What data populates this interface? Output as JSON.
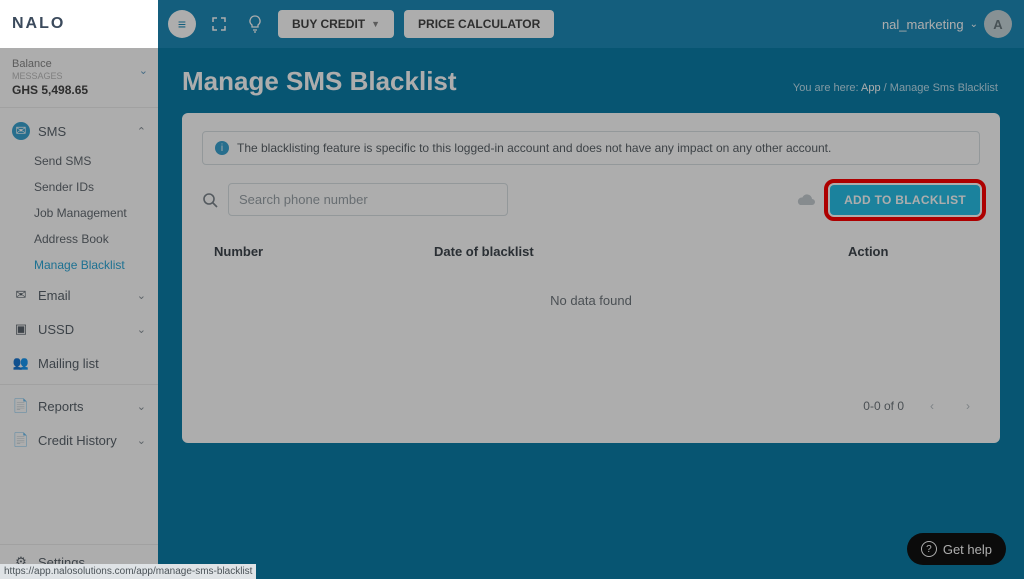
{
  "brand": "NALO",
  "topbar": {
    "buy_credit": "BUY CREDIT",
    "price_calc": "PRICE CALCULATOR",
    "username": "nal_marketing",
    "avatar_initial": "A"
  },
  "balance": {
    "label": "Balance",
    "sublabel": "MESSAGES",
    "value": "GHS 5,498.65"
  },
  "nav": {
    "sms": {
      "label": "SMS"
    },
    "sms_items": [
      "Send SMS",
      "Sender IDs",
      "Job Management",
      "Address Book",
      "Manage Blacklist"
    ],
    "email": "Email",
    "ussd": "USSD",
    "mailing": "Mailing list",
    "reports": "Reports",
    "credit_history": "Credit History",
    "settings": "Settings"
  },
  "page": {
    "title": "Manage SMS Blacklist",
    "crumb_prefix": "You are here:",
    "crumb_app": "App",
    "crumb_current": "Manage Sms Blacklist",
    "alert": "The blacklisting feature is specific to this logged-in account and does not have any impact on any other account.",
    "search_placeholder": "Search phone number",
    "add_btn": "ADD TO BLACKLIST",
    "columns": {
      "number": "Number",
      "date": "Date of blacklist",
      "action": "Action"
    },
    "empty": "No data found",
    "pager": "0-0 of 0"
  },
  "help": "Get help",
  "status_url": "https://app.nalosolutions.com/app/manage-sms-blacklist"
}
